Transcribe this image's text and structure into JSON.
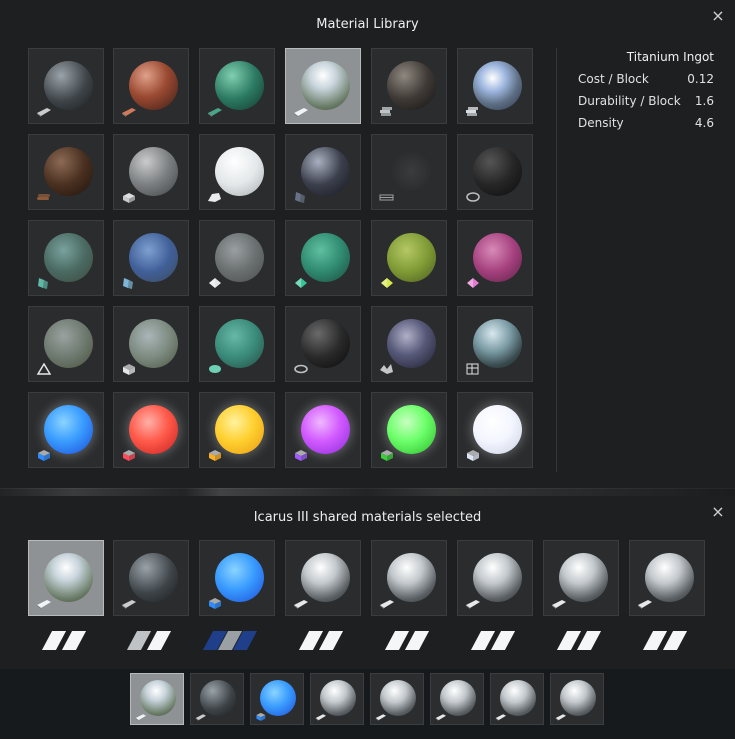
{
  "library": {
    "title": "Material Library",
    "close_label": "×",
    "cells": [
      {
        "s": "radial-gradient(circle at 35% 30%,#9aa3aa,#3d4347 55%,#1b1e20)",
        "b": "ingot",
        "bc": "#c9cdd0"
      },
      {
        "s": "radial-gradient(circle at 35% 30%,#e0a08a,#9b4a32 45%,#3b1d16)",
        "b": "ingot",
        "bc": "#d07a5c"
      },
      {
        "s": "radial-gradient(circle at 35% 30%,#7fcfb2,#2c7a61 50%,#123a2e)",
        "b": "ingot",
        "bc": "#4aa48a"
      },
      {
        "s": "radial-gradient(circle at 45% 30%,#ffffff,#c8d4dc 30%,#6c7f6a 70%,#3b4330)",
        "b": "ingot",
        "bc": "#f1f3f4",
        "sel": true
      },
      {
        "s": "radial-gradient(circle at 35% 30%,#8f8880,#3f3a36 50%,#141210)",
        "b": "bars",
        "bc": "#bfc4c8"
      },
      {
        "s": "radial-gradient(circle at 40% 35%,#ffffff,#9fb8e0 30%,#5d6e84 60%,#2a3444)",
        "b": "bars",
        "bc": "#d8dde2"
      },
      {
        "s": "radial-gradient(circle at 35% 30%,#8c6a55,#4a3020 50%,#1e120b)",
        "b": "logs",
        "bc": "#8a5a3a"
      },
      {
        "s": "radial-gradient(circle at 35% 30%,#c9cbcc,#7b7e80 50%,#3f4244)",
        "b": "block",
        "bc": "#c7c9ca"
      },
      {
        "s": "radial-gradient(circle at 40% 30%,#ffffff,#e4e8ea 50%,#a8adb0)",
        "b": "rock",
        "bc": "#e9ecee"
      },
      {
        "s": "radial-gradient(circle at 35% 30%,#aab0c0,#3b3f4c 50%,#16181e)",
        "b": "glass",
        "bc": "#6a7386"
      },
      {
        "s": "radial-gradient(circle at 50% 50%,#3a3c3e,#2a2c2e 60%)",
        "b": "mesh",
        "bc": "#9ea2a5"
      },
      {
        "s": "radial-gradient(circle at 35% 30%,#555,#262626 50%,#0c0c0c)",
        "b": "coil",
        "bc": "#c0c3c5"
      },
      {
        "s": "radial-gradient(circle at 40% 35%,#7aa29e,#4a6a62 50%,#3c4a3c)",
        "b": "glass",
        "bc": "#5fb7a8"
      },
      {
        "s": "radial-gradient(circle at 40% 35%,#7ea0d0,#41609a 50%,#3b4a5a)",
        "b": "glass",
        "bc": "#7fb6d8"
      },
      {
        "s": "radial-gradient(circle at 40% 35%,#9a9fa2,#6a6f70 50%,#4a4e4c)",
        "b": "gem",
        "bc": "#e4e7e9"
      },
      {
        "s": "radial-gradient(circle at 40% 35%,#5fbfa0,#2f8a70 50%,#1d4a3c)",
        "b": "gem",
        "bc": "#3ac49a"
      },
      {
        "s": "radial-gradient(circle at 40% 35%,#b5c865,#7f9b35 50%,#4a5a20)",
        "b": "gem",
        "bc": "#d7e84a"
      },
      {
        "s": "radial-gradient(circle at 40% 35%,#d88ab8,#a5407e 50%,#5a2244)",
        "b": "gem",
        "bc": "#e37bd0"
      },
      {
        "s": "radial-gradient(circle at 40% 35%,#9aa2a0,#6e7a70 50%,#4a503c)",
        "b": "tri",
        "bc": "#e4e7e9"
      },
      {
        "s": "radial-gradient(circle at 40% 35%,#aab6b8,#7c8a80 50%,#4c5440)",
        "b": "cube",
        "bc": "#e4e7e9"
      },
      {
        "s": "radial-gradient(circle at 40% 35%,#68b8a8,#3a8a7a 50%,#244a40)",
        "b": "drop",
        "bc": "#6fd0b6"
      },
      {
        "s": "radial-gradient(circle at 35% 30%,#6a6a6a,#2a2a2a 50%,#0a0a0a)",
        "b": "ring",
        "bc": "#bfc2c4"
      },
      {
        "s": "radial-gradient(circle at 40% 35%,#b0b0c8,#565878 45%,#1d1e2c)",
        "b": "scrap",
        "bc": "#c4c7ca"
      },
      {
        "s": "radial-gradient(circle at 40% 30%,#d8e8ee,#7a9aa4 40%,#3a4c50 70%,#1c2426)",
        "b": "wire",
        "bc": "#e0e3e5"
      },
      {
        "s": "radial-gradient(circle at 40% 35%,#8ad4ff,#3a9cff 45%,#1a4cd8)",
        "b": "cube",
        "bc": "#2f8cff"
      },
      {
        "s": "radial-gradient(circle at 40% 35%,#ffb0a8,#ff5a4a 45%,#c82020)",
        "b": "cube",
        "bc": "#ff4a5a"
      },
      {
        "s": "radial-gradient(circle at 40% 35%,#fff2a0,#ffd030 45%,#e89a10)",
        "b": "cube",
        "bc": "#ffb020"
      },
      {
        "s": "radial-gradient(circle at 40% 35%,#f0b8ff,#d25aff 45%,#8a2ad8)",
        "b": "cube",
        "bc": "#a05aff"
      },
      {
        "s": "radial-gradient(circle at 40% 35%,#c8ffc0,#6cff6a 45%,#2ab82a)",
        "b": "cube",
        "bc": "#3acf3a"
      },
      {
        "s": "radial-gradient(circle at 40% 35%,#ffffff,#f4f6ff 45%,#c8d0e0)",
        "b": "cube",
        "bc": "#dfe4f4"
      }
    ]
  },
  "details": {
    "name": "Titanium Ingot",
    "rows": [
      {
        "label": "Cost / Block",
        "value": "0.12"
      },
      {
        "label": "Durability / Block",
        "value": "1.6"
      },
      {
        "label": "Density",
        "value": "4.6"
      }
    ]
  },
  "selection": {
    "title": "Icarus III shared materials selected",
    "close_label": "×",
    "slots": [
      {
        "s": "radial-gradient(circle at 45% 30%,#ffffff,#c8d4dc 30%,#6c7f6a 70%,#3b4330)",
        "b": "ingot",
        "bc": "#f1f3f4",
        "sel": true,
        "pair": [
          "#f4f6f7",
          "#f4f6f7"
        ]
      },
      {
        "s": "radial-gradient(circle at 35% 30%,#9aa3aa,#3d4347 55%,#1b1e20)",
        "b": "ingot",
        "bc": "#c9cdd0",
        "pair": [
          "#bfc3c6",
          "#f4f6f7"
        ]
      },
      {
        "s": "radial-gradient(circle at 40% 35%,#8ad4ff,#3a9cff 45%,#1a4cd8)",
        "b": "cube",
        "bc": "#2f8cff",
        "pair": [
          "#1f3f8a",
          "#9aa0a4",
          "#1f3f8a"
        ]
      },
      {
        "s": "radial-gradient(circle at 40% 30%,#ffffff,#c2c8cc 35%,#5a6064 70%,#2a2e30)",
        "b": "ingot",
        "bc": "#e6e8ea",
        "pair": [
          "#f4f6f7",
          "#f4f6f7"
        ]
      },
      {
        "s": "radial-gradient(circle at 40% 30%,#ffffff,#c2c8cc 35%,#5a6064 70%,#2a2e30)",
        "b": "ingot",
        "bc": "#e6e8ea",
        "pair": [
          "#f4f6f7",
          "#f4f6f7"
        ]
      },
      {
        "s": "radial-gradient(circle at 40% 30%,#ffffff,#c2c8cc 35%,#5a6064 70%,#2a2e30)",
        "b": "ingot",
        "bc": "#e6e8ea",
        "pair": [
          "#f4f6f7",
          "#f4f6f7"
        ]
      },
      {
        "s": "radial-gradient(circle at 40% 30%,#ffffff,#c2c8cc 35%,#5a6064 70%,#2a2e30)",
        "b": "ingot",
        "bc": "#e6e8ea",
        "pair": [
          "#f4f6f7",
          "#f4f6f7"
        ]
      },
      {
        "s": "radial-gradient(circle at 40% 30%,#ffffff,#c2c8cc 35%,#5a6064 70%,#2a2e30)",
        "b": "ingot",
        "bc": "#e6e8ea",
        "pair": [
          "#f4f6f7",
          "#f4f6f7"
        ]
      }
    ]
  }
}
